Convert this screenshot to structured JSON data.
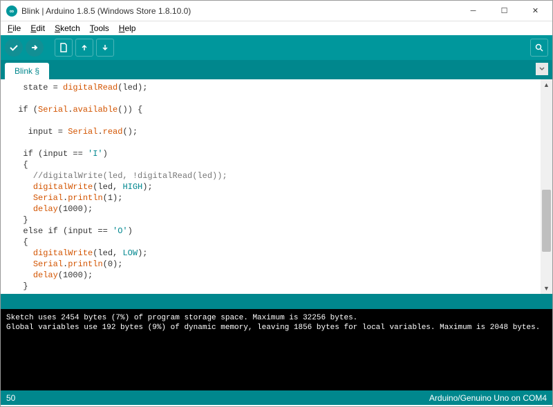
{
  "window": {
    "title": "Blink | Arduino 1.8.5 (Windows Store 1.8.10.0)",
    "icon_glyph": "∞"
  },
  "menu": {
    "file": "File",
    "edit": "Edit",
    "sketch": "Sketch",
    "tools": "Tools",
    "help": "Help"
  },
  "tabs": {
    "active": "Blink §"
  },
  "code": {
    "line0_pre": "  state = ",
    "line0_fn": "digitalRead",
    "line0_post": "(led);",
    "line2_pre": " if (",
    "line2_fn": "Serial",
    "line2_mid": ".",
    "line2_fn2": "available",
    "line2_post": "()) {",
    "line4_pre": "   input = ",
    "line4_fn": "Serial",
    "line4_mid": ".",
    "line4_fn2": "read",
    "line4_post": "();",
    "line6": "  if (input == ",
    "line6_lit": "'I'",
    "line6_post": ")",
    "line7": "  {",
    "line8_com": "    //digitalWrite(led, !digitalRead(led));",
    "line9_pre": "    ",
    "line9_fn": "digitalWrite",
    "line9_mid": "(led, ",
    "line9_lit": "HIGH",
    "line9_post": ");",
    "line10_pre": "    ",
    "line10_fn": "Serial",
    "line10_mid": ".",
    "line10_fn2": "println",
    "line10_post": "(1);",
    "line11_pre": "    ",
    "line11_fn": "delay",
    "line11_post": "(1000);",
    "line12": "  }",
    "line13_pre": "  else if (input == ",
    "line13_lit": "'O'",
    "line13_post": ")",
    "line14": "  {",
    "line15_pre": "    ",
    "line15_fn": "digitalWrite",
    "line15_mid": "(led, ",
    "line15_lit": "LOW",
    "line15_post": ");",
    "line16_pre": "    ",
    "line16_fn": "Serial",
    "line16_mid": ".",
    "line16_fn2": "println",
    "line16_post": "(0);",
    "line17_pre": "    ",
    "line17_fn": "delay",
    "line17_post": "(1000);",
    "line18": "  }"
  },
  "console": {
    "line1": "Sketch uses 2454 bytes (7%) of program storage space. Maximum is 32256 bytes.",
    "line2": "Global variables use 192 bytes (9%) of dynamic memory, leaving 1856 bytes for local variables. Maximum is 2048 bytes."
  },
  "status": {
    "left": "50",
    "right": "Arduino/Genuino Uno on COM4"
  }
}
